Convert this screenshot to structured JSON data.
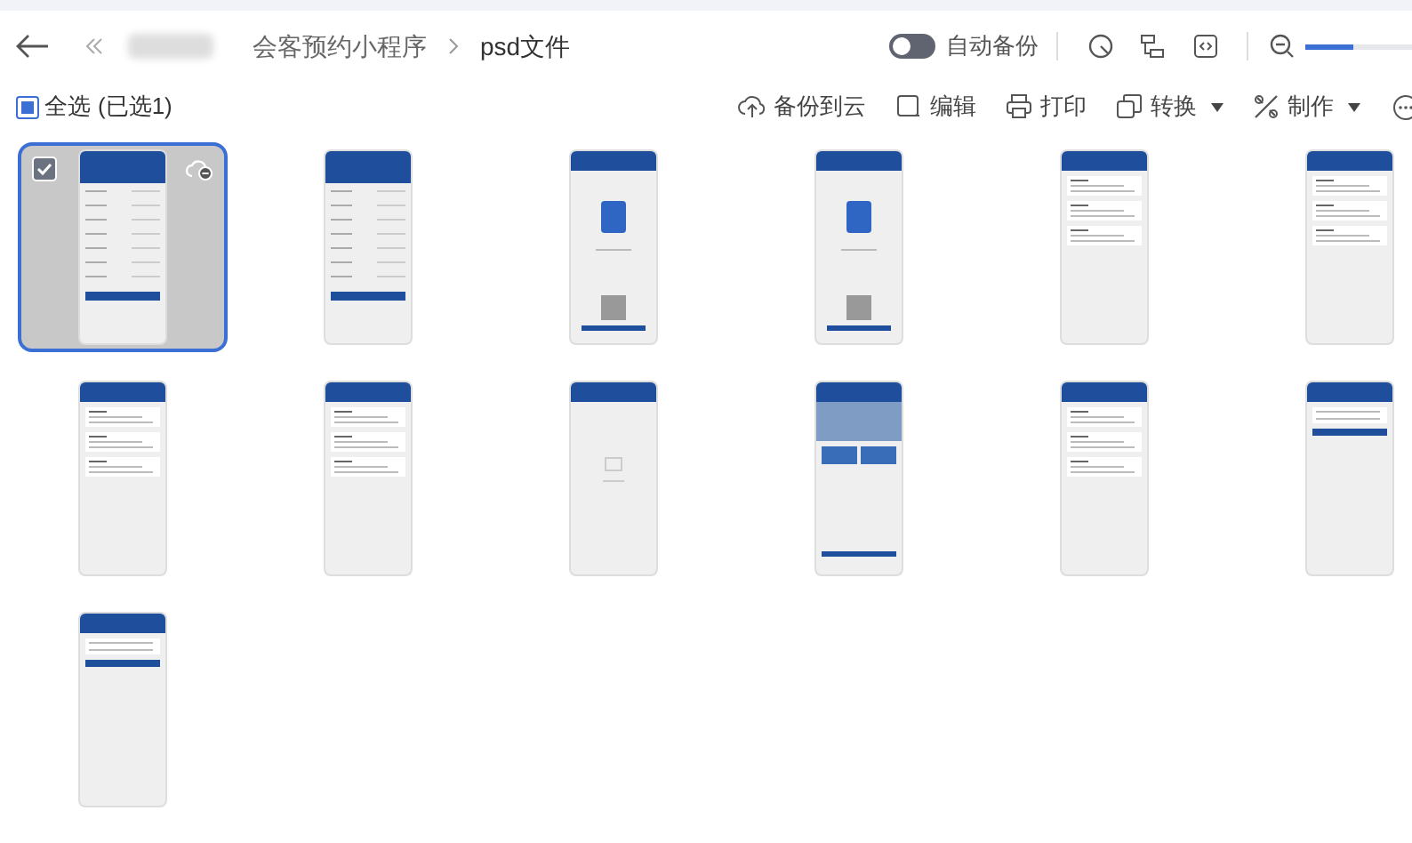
{
  "breadcrumb": {
    "items": [
      "会客预约小程序",
      "psd文件"
    ]
  },
  "auto_backup": {
    "label": "自动备份",
    "on": false
  },
  "zoom": {
    "level": 0.45
  },
  "select_all": {
    "label": "全选",
    "selected_count": "(已选1)",
    "indeterminate": true
  },
  "toolbar": [
    {
      "label": "备份到云",
      "kind": "upload",
      "dropdown": false
    },
    {
      "label": "编辑",
      "kind": "edit",
      "dropdown": false
    },
    {
      "label": "打印",
      "kind": "print",
      "dropdown": false
    },
    {
      "label": "转换",
      "kind": "convert",
      "dropdown": true
    },
    {
      "label": "制作",
      "kind": "make",
      "dropdown": true
    }
  ],
  "files": [
    {
      "kind": "form",
      "selected": true
    },
    {
      "kind": "form",
      "selected": false
    },
    {
      "kind": "qr",
      "selected": false
    },
    {
      "kind": "qr",
      "selected": false
    },
    {
      "kind": "list",
      "selected": false
    },
    {
      "kind": "list",
      "selected": false
    },
    {
      "kind": "list",
      "selected": false
    },
    {
      "kind": "list",
      "selected": false
    },
    {
      "kind": "empty",
      "selected": false
    },
    {
      "kind": "banner",
      "selected": false
    },
    {
      "kind": "list",
      "selected": false
    },
    {
      "kind": "short",
      "selected": false
    },
    {
      "kind": "short",
      "selected": false
    }
  ]
}
